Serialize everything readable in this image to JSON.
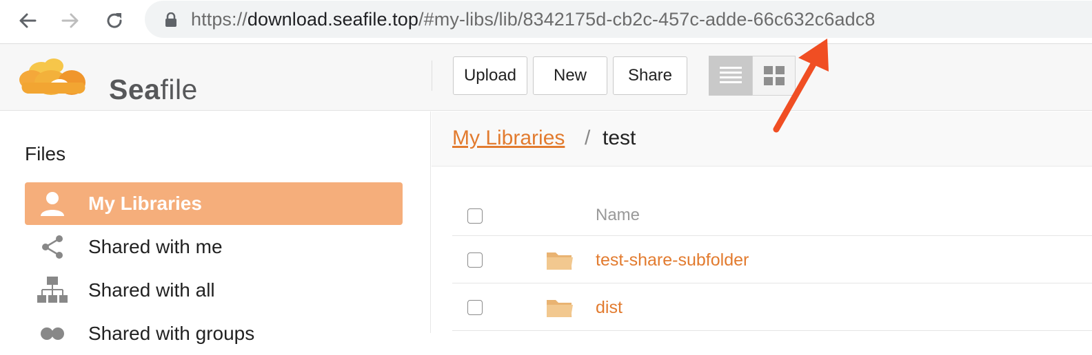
{
  "browser": {
    "url_scheme": "https://",
    "url_host": "download.seafile.top",
    "url_path": "/#my-libs/lib/8342175d-cb2c-457c-adde-66c632c6adc8",
    "icons": [
      "back-arrow-icon",
      "forward-arrow-icon",
      "reload-icon",
      "lock-icon"
    ]
  },
  "app": {
    "logo_text_bold": "Sea",
    "logo_text_rest": "file",
    "brand_color": "#f5ae7b",
    "link_color": "#e27b2f"
  },
  "toolbar": {
    "upload_label": "Upload",
    "new_label": "New",
    "share_label": "Share",
    "view_modes": [
      "list",
      "grid"
    ],
    "active_view": "list"
  },
  "sidebar": {
    "title": "Files",
    "items": [
      {
        "label": "My Libraries",
        "icon": "user-icon",
        "active": true
      },
      {
        "label": "Shared with me",
        "icon": "share-icon",
        "active": false
      },
      {
        "label": "Shared with all",
        "icon": "org-chart-icon",
        "active": false
      },
      {
        "label": "Shared with groups",
        "icon": "group-icon",
        "active": false
      }
    ]
  },
  "breadcrumb": {
    "root": "My Libraries",
    "separator": "/",
    "current": "test"
  },
  "table": {
    "header_name": "Name",
    "rows": [
      {
        "name": "test-share-subfolder",
        "type": "folder"
      },
      {
        "name": "dist",
        "type": "folder"
      }
    ]
  },
  "annotation": {
    "arrow_color": "#f04e23",
    "arrow_icon": "red-arrow-icon"
  }
}
